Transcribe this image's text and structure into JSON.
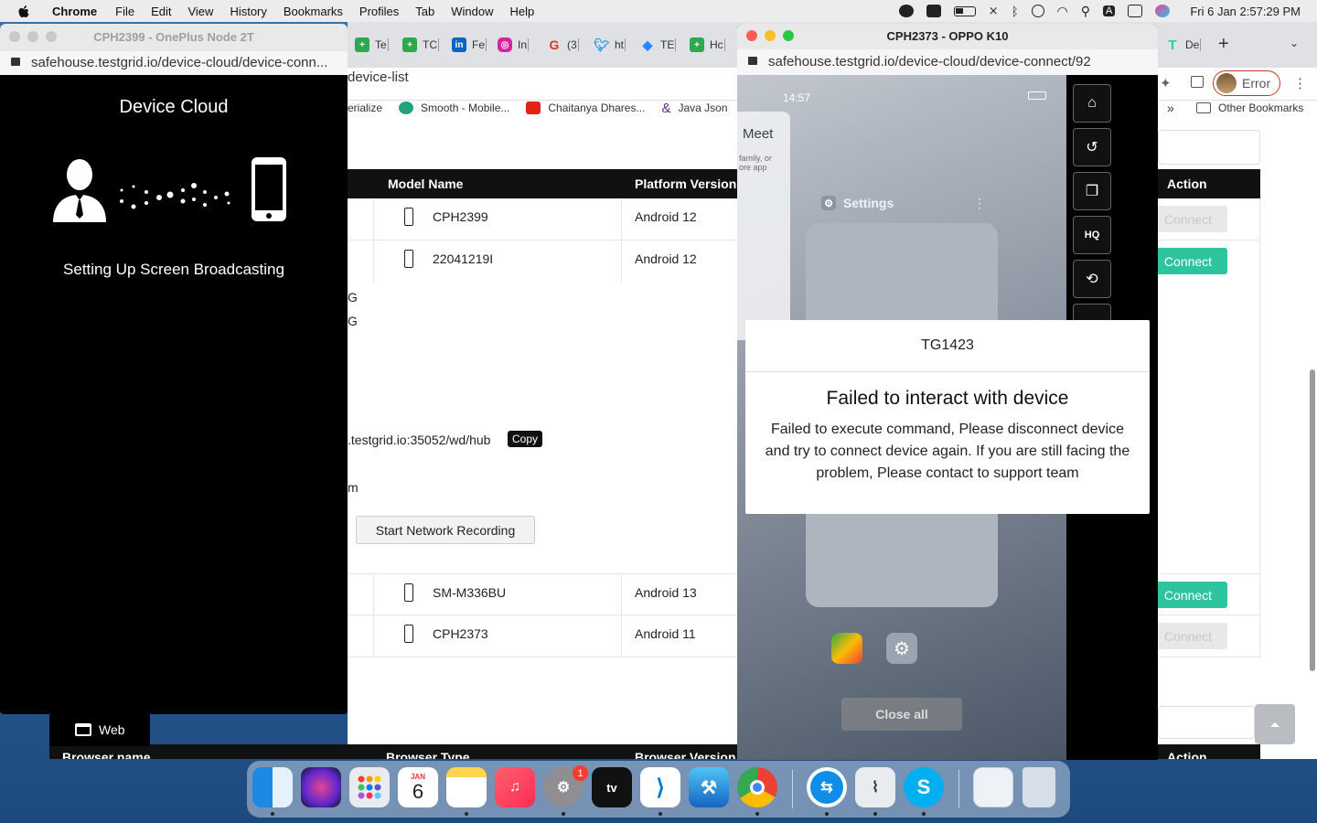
{
  "menubar": {
    "app_name": "Chrome",
    "items": [
      "File",
      "Edit",
      "View",
      "History",
      "Bookmarks",
      "Profiles",
      "Tab",
      "Window",
      "Help"
    ],
    "clock": "Fri 6 Jan  2:57:29 PM",
    "input_source": "A"
  },
  "main_browser": {
    "tabs": [
      {
        "label": "Te",
        "icon": "testgrid-icon",
        "color": "#2ea84e"
      },
      {
        "label": "TC",
        "icon": "testgrid-icon",
        "color": "#2ea84e"
      },
      {
        "label": "Fe",
        "icon": "linkedin-icon",
        "color": "#0a66c2"
      },
      {
        "label": "In",
        "icon": "instagram-icon",
        "color": "#d6249f"
      },
      {
        "label": "(3",
        "icon": "g-icon",
        "color": "#e03030"
      },
      {
        "label": "ht",
        "icon": "twitter-icon",
        "color": "#1d9bf0"
      },
      {
        "label": "TE",
        "icon": "jira-icon",
        "color": "#2684ff"
      },
      {
        "label": "Hc",
        "icon": "testgrid-icon",
        "color": "#2ea84e"
      },
      {
        "label": "De",
        "icon": "testgrid-icon",
        "color": "#2ecbb0"
      }
    ],
    "new_tab": "+",
    "url_fragment": "device-list",
    "profile_label": "Error",
    "bookmarks": [
      {
        "label": "erialize",
        "color": ""
      },
      {
        "label": "Smooth - Mobile...",
        "color": "#1fa37a"
      },
      {
        "label": "Chaitanya Dhares...",
        "color": "#e62117"
      },
      {
        "label": "Java Json",
        "color": "#5b2a86"
      }
    ],
    "bookmarks_more": "»",
    "other_bookmarks": "Other Bookmarks"
  },
  "device_table": {
    "headers": {
      "model": "Model Name",
      "platform": "Platform Version",
      "action": "Action"
    },
    "rows": [
      {
        "model": "CPH2399",
        "platform": "Android 12",
        "action": "Connect",
        "enabled": false
      },
      {
        "model": "22041219I",
        "platform": "Android 12",
        "action": "Connect",
        "enabled": true
      },
      {
        "model": "SM-M336BU",
        "platform": "Android 13",
        "action": "Connect",
        "enabled": true
      },
      {
        "model": "CPH2373",
        "platform": "Android 11",
        "action": "Connect",
        "enabled": false
      }
    ],
    "fragments": {
      "g1": "G",
      "g2": "G",
      "hub": ".testgrid.io:35052/wd/hub",
      "m": "m"
    },
    "copy_label": "Copy",
    "network_recording": "Start Network Recording",
    "web_tab": "Web",
    "bottom_headers": {
      "browser_name": "Browser name",
      "browser_type": "Browser Type",
      "browser_version": "Browser Version",
      "action": "Action"
    }
  },
  "left_popup": {
    "title": "CPH2399 - OnePlus Node 2T",
    "url": "safehouse.testgrid.io/device-cloud/device-conn...",
    "heading": "Device Cloud",
    "status": "Setting Up Screen Broadcasting"
  },
  "right_popup": {
    "title": "CPH2373 - OPPO K10",
    "url": "safehouse.testgrid.io/device-cloud/device-connect/92",
    "phone_time": "14:57",
    "recents_app": "Settings",
    "left_card_title": "Meet",
    "left_card_text": "family, or ore app",
    "close_all": "Close all",
    "sidebar_buttons": [
      "home-icon",
      "history-icon",
      "copy-icon",
      "hd-icon",
      "rotate-icon"
    ]
  },
  "modal": {
    "device_id": "TG1423",
    "title": "Failed to interact with device",
    "message": "Failed to execute command, Please disconnect device and try to connect device again. If you are still facing the problem, Please contact to support team"
  },
  "dock": {
    "calendar_month": "JAN",
    "calendar_day": "6",
    "settings_badge": "1",
    "apps": [
      "finder",
      "siri",
      "launchpad",
      "calendar",
      "notes",
      "music",
      "system-preferences",
      "apple-tv",
      "vscode",
      "xcode",
      "chrome",
      "teamviewer",
      "cable-utility",
      "skype",
      "preview",
      "trash"
    ]
  },
  "colors": {
    "accent": "#2ec4a0",
    "disabled": "#e8e8e8",
    "error_ring": "#c0392b"
  }
}
